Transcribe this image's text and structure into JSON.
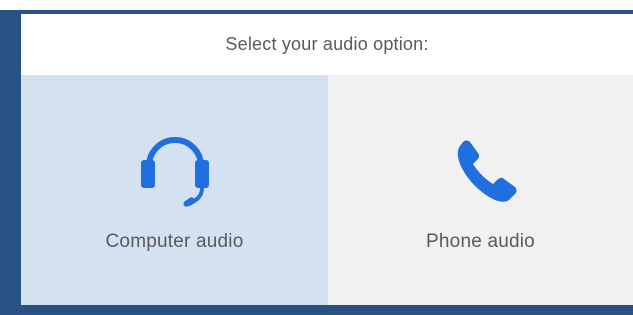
{
  "dialog": {
    "title": "Select your audio option:"
  },
  "options": [
    {
      "label": "Computer audio",
      "icon": "headset-icon",
      "selected": true
    },
    {
      "label": "Phone audio",
      "icon": "phone-icon",
      "selected": false
    }
  ],
  "colors": {
    "accent": "#1f6fde",
    "selected_background": "#d3e1f1",
    "unselected_background": "#f1f1f1",
    "frame": "#2a5184",
    "text": "#5a5a5a"
  }
}
